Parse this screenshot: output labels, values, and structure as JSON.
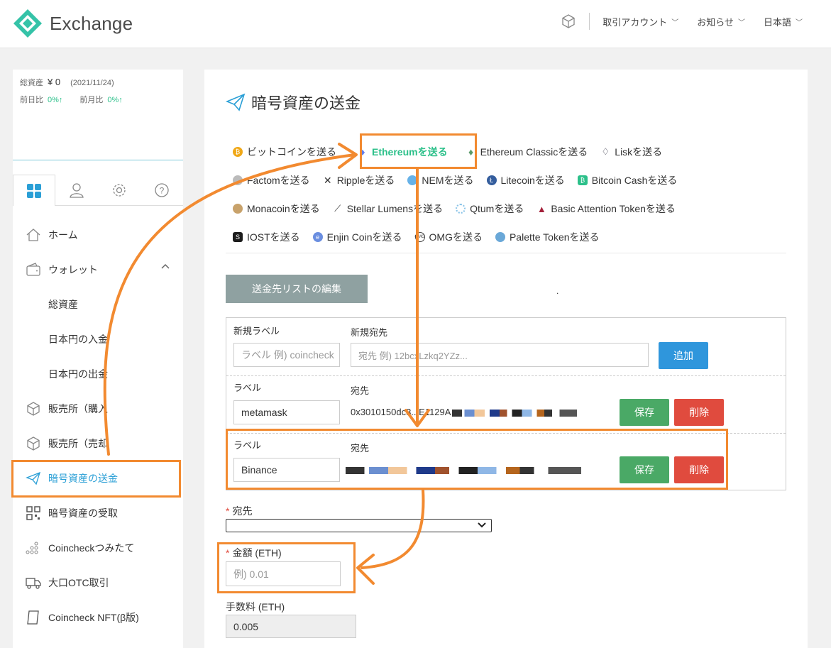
{
  "header": {
    "logo_text": "Exchange",
    "nav": [
      {
        "label": "取引アカウント"
      },
      {
        "label": "お知らせ"
      },
      {
        "label": "日本語"
      }
    ]
  },
  "summary": {
    "total_label": "総資産",
    "total_value": "¥ 0",
    "date": "(2021/11/24)",
    "day_label": "前日比",
    "day_value": "0%↑",
    "month_label": "前月比",
    "month_value": "0%↑"
  },
  "sidebar": {
    "tabs": [
      "grid-icon",
      "user-icon",
      "gear-icon",
      "help-icon"
    ],
    "items": [
      {
        "label": "ホーム"
      },
      {
        "label": "ウォレット"
      },
      {
        "label": "総資産"
      },
      {
        "label": "日本円の入金"
      },
      {
        "label": "日本円の出金"
      },
      {
        "label": "販売所（購入"
      },
      {
        "label": "販売所（売却"
      },
      {
        "label": "暗号資産の送金"
      },
      {
        "label": "暗号資産の受取"
      },
      {
        "label": "Coincheckつみたて"
      },
      {
        "label": "大口OTC取引"
      },
      {
        "label": "Coincheck NFT(β版)"
      }
    ]
  },
  "main": {
    "title": "暗号資産の送金",
    "coins": [
      {
        "label": "ビットコインを送る",
        "color": "#f0a818"
      },
      {
        "label": "Ethereumを送る",
        "color": "#627eea"
      },
      {
        "label": "Ethereum Classicを送る",
        "color": "#5b9b6a"
      },
      {
        "label": "Liskを送る",
        "color": "#1a1a2e"
      },
      {
        "label": "Factomを送る",
        "color": "#999999"
      },
      {
        "label": "Rippleを送る",
        "color": "#333333"
      },
      {
        "label": "NEMを送る",
        "color": "#67b2e8"
      },
      {
        "label": "Litecoinを送る",
        "color": "#345d9d"
      },
      {
        "label": "Bitcoin Cashを送る",
        "color": "#2cc08a"
      },
      {
        "label": "Monacoinを送る",
        "color": "#c8a26b"
      },
      {
        "label": "Stellar Lumensを送る",
        "color": "#333333"
      },
      {
        "label": "Qtumを送る",
        "color": "#8ac4e8"
      },
      {
        "label": "Basic Attention Tokenを送る",
        "color": "#a3203a"
      },
      {
        "label": "IOSTを送る",
        "color": "#1c1c1c"
      },
      {
        "label": "Enjin Coinを送る",
        "color": "#6a8ee0"
      },
      {
        "label": "OMGを送る",
        "color": "#444444"
      },
      {
        "label": "Palette Tokenを送る",
        "color": "#6aa8d8"
      }
    ],
    "edit_list_button": "送金先リストの編集",
    "dot": ".",
    "new_label_header": "新規ラベル",
    "new_address_header": "新規宛先",
    "new_label_placeholder": "ラベル 例) coincheck",
    "new_address_placeholder": "宛先 例) 12bcxLzkq2YZz...",
    "add_button": "追加",
    "rows": [
      {
        "label_header": "ラベル",
        "address_header": "宛先",
        "label_value": "metamask",
        "address_value": "0x3010150dc3...E1129A",
        "save": "保存",
        "delete": "削除"
      },
      {
        "label_header": "ラベル",
        "address_header": "宛先",
        "label_value": "Binance",
        "address_value": "",
        "save": "保存",
        "delete": "削除"
      }
    ],
    "destination_label": "宛先",
    "amount_label": "金額 (ETH)",
    "amount_placeholder": "例) 0.01",
    "fee_label": "手数料 (ETH)",
    "fee_value": "0.005",
    "required_mark": "*"
  },
  "annotation_color": "#f28a30"
}
